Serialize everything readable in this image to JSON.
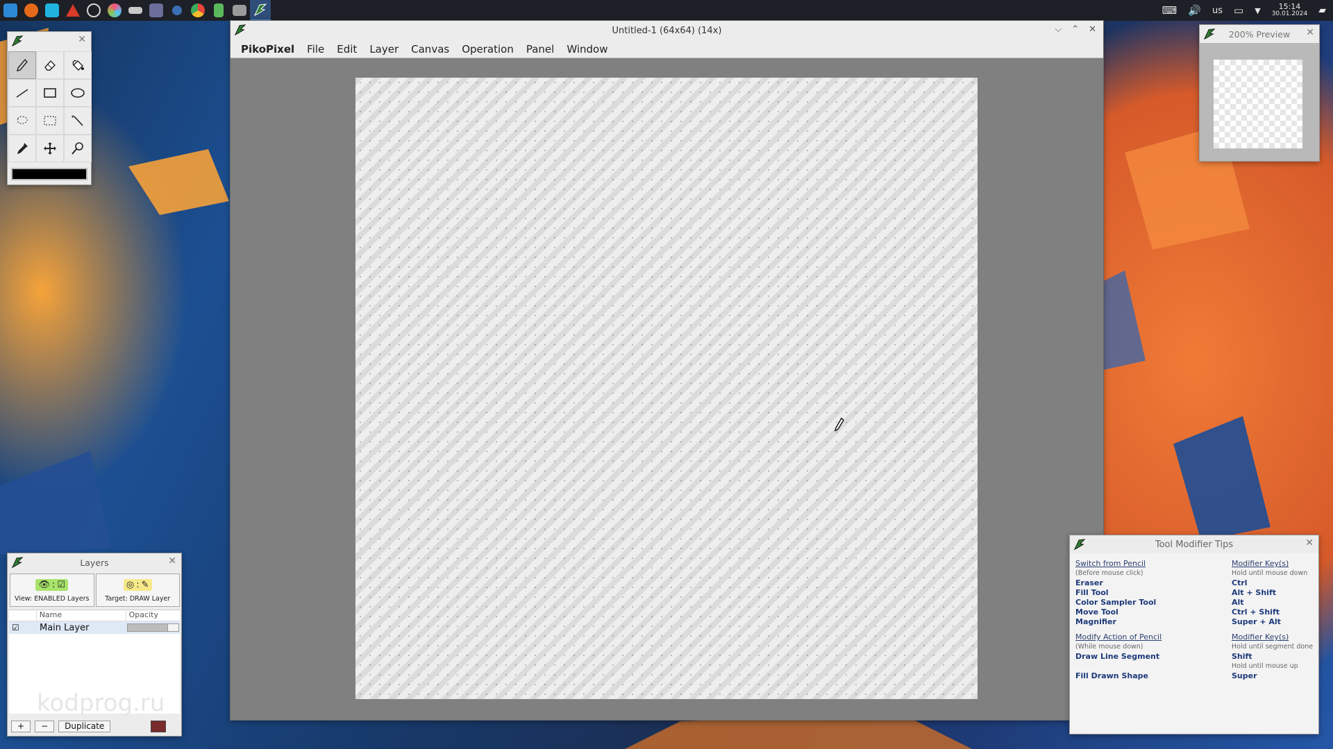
{
  "taskbar": {
    "apps": [
      {
        "name": "app-launcher-icon",
        "color": "#2d89d6"
      },
      {
        "name": "firefox-icon",
        "color": "#e66a1a"
      },
      {
        "name": "app-s-icon",
        "color": "#21b3e0"
      },
      {
        "name": "app-red-triangle-icon",
        "color": "#d93b2b"
      },
      {
        "name": "app-circle-icon",
        "color": "#bfbfbf"
      },
      {
        "name": "app-colorball-icon",
        "color": "#ff4f7a"
      },
      {
        "name": "app-mask-icon",
        "color": "#c9c9c9"
      },
      {
        "name": "app-grid-icon",
        "color": "#6d6d9a"
      },
      {
        "name": "app-blue-circle-icon",
        "color": "#3b6fb5"
      },
      {
        "name": "app-chrome-icon",
        "color": "#e8453c"
      },
      {
        "name": "app-green-icon",
        "color": "#5cb85c"
      },
      {
        "name": "app-files-icon",
        "color": "#9a9a9a"
      },
      {
        "name": "pikopixel-task-icon",
        "color": "#2e7d32"
      }
    ],
    "keyboard_layout": "us",
    "time": "15:14",
    "date": "30.01.2024"
  },
  "tools_palette": {
    "close_glyph": "✕",
    "tools": [
      "pencil",
      "eraser",
      "fill-bucket",
      "line",
      "rectangle",
      "ellipse",
      "freeform-select",
      "rect-select",
      "magic-wand",
      "color-sampler",
      "move",
      "magnifier"
    ],
    "selected_tool": "pencil",
    "current_color": "#000000"
  },
  "main_window": {
    "title": "Untitled-1 (64x64) (14x)",
    "controls": {
      "minimize": "⌵",
      "maximize": "⌃",
      "close": "✕"
    },
    "menu": {
      "app_name": "PikoPixel",
      "items": [
        "File",
        "Edit",
        "Layer",
        "Canvas",
        "Operation",
        "Panel",
        "Window"
      ]
    }
  },
  "preview_window": {
    "title": "200% Preview",
    "close_glyph": "✕"
  },
  "layers_window": {
    "title": "Layers",
    "close_glyph": "✕",
    "view_mode_label": "View: ENABLED Layers",
    "target_mode_label": "Target: DRAW Layer",
    "columns": {
      "name": "Name",
      "opacity": "Opacity"
    },
    "layers": [
      {
        "enabled_glyph": "☑",
        "name": "Main Layer",
        "opacity": 0.85
      }
    ],
    "buttons": {
      "add": "+",
      "remove": "−",
      "duplicate": "Duplicate"
    },
    "watermark": "kodprog.ru"
  },
  "tips_window": {
    "title": "Tool Modifier Tips",
    "close_glyph": "✕",
    "switch_section": {
      "left_header": "Switch from Pencil",
      "left_note": "(Before mouse click)",
      "right_header": "Modifier Key(s)",
      "right_note": "Hold until mouse down",
      "rows": [
        {
          "action": "Eraser",
          "keys": "Ctrl"
        },
        {
          "action": "Fill Tool",
          "keys": "Alt + Shift"
        },
        {
          "action": "Color Sampler Tool",
          "keys": "Alt"
        },
        {
          "action": "Move Tool",
          "keys": "Ctrl + Shift"
        },
        {
          "action": "Magnifier",
          "keys": "Super + Alt"
        }
      ]
    },
    "modify_section": {
      "left_header": "Modify Action of Pencil",
      "left_note": "(While mouse down)",
      "right_header": "Modifier Key(s)",
      "right_note": "Hold until segment done",
      "row1_action": "Draw Line Segment",
      "row1_keys": "Shift",
      "mid_note": "Hold until mouse up",
      "row2_action": "Fill Drawn Shape",
      "row2_keys": "Super"
    }
  }
}
